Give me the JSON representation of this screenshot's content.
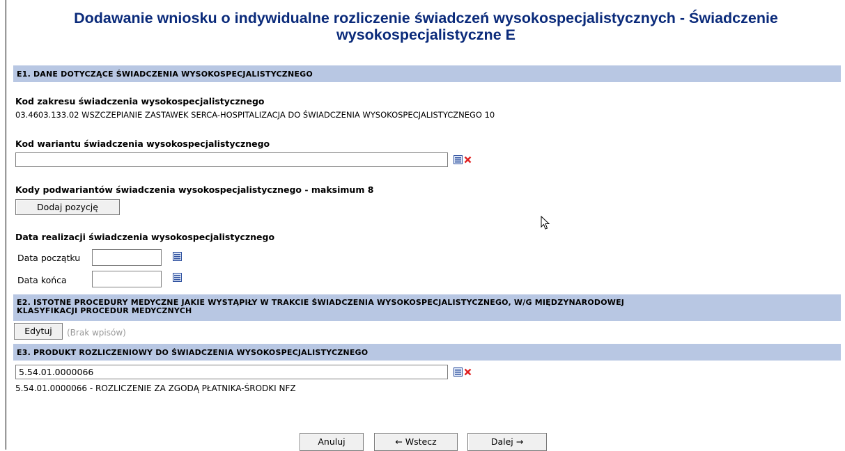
{
  "page": {
    "title_line1": "Dodawanie wniosku o indywidualne rozliczenie świadczeń wysokospecjalistycznych - Świadczenie",
    "title_line2": "wysokospecjalistyczne E"
  },
  "e1": {
    "header": "E1. DANE DOTYCZĄCE ŚWIADCZENIA WYSOKOSPECJALISTYCZNEGO",
    "scope_label": "Kod zakresu świadczenia wysokospecjalistycznego",
    "scope_value": "03.4603.133.02 WSZCZEPIANIE ZASTAWEK SERCA-HOSPITALIZACJA DO ŚWIADCZENIA WYSOKOSPECJALISTYCZNEGO 10",
    "variant_label": "Kod wariantu świadczenia wysokospecjalistycznego",
    "variant_value": "",
    "subvariants_label": "Kody podwariantów świadczenia wysokospecjalistycznego - maksimum 8",
    "add_position_button": "Dodaj pozycję",
    "date_label": "Data realizacji świadczenia wysokospecjalistycznego",
    "date_start_label": "Data początku",
    "date_start_value": "",
    "date_end_label": "Data końca",
    "date_end_value": ""
  },
  "e2": {
    "header_line1": "E2. ISTOTNE PROCEDURY MEDYCZNE JAKIE WYSTĄPIŁY W TRAKCIE ŚWIADCZENIA WYSOKOSPECJALISTYCZNEGO, W/G MIĘDZYNARODOWEJ",
    "header_line2": "KLASYFIKACJI PROCEDUR MEDYCZNYCH",
    "edit_button": "Edytuj",
    "empty_text": "(Brak wpisów)"
  },
  "e3": {
    "header": "E3. PRODUKT ROZLICZENIOWY DO ŚWIADCZENIA WYSOKOSPECJALISTYCZNEGO",
    "product_value": "5.54.01.0000066",
    "product_description": "5.54.01.0000066 - ROZLICZENIE ZA ZGODĄ PŁATNIKA-ŚRODKI NFZ"
  },
  "footer": {
    "cancel_button": "Anuluj",
    "back_button": "← Wstecz",
    "next_button": "Dalej →"
  },
  "icons": {
    "list_picker": "list-picker-icon",
    "clear": "clear-x-icon",
    "calendar": "calendar-icon",
    "cursor": "mouse-cursor"
  },
  "colors": {
    "title": "#0a2a7a",
    "section_bar": "#b8c7e3",
    "clear_x": "#e02020",
    "muted_text": "#999999"
  }
}
